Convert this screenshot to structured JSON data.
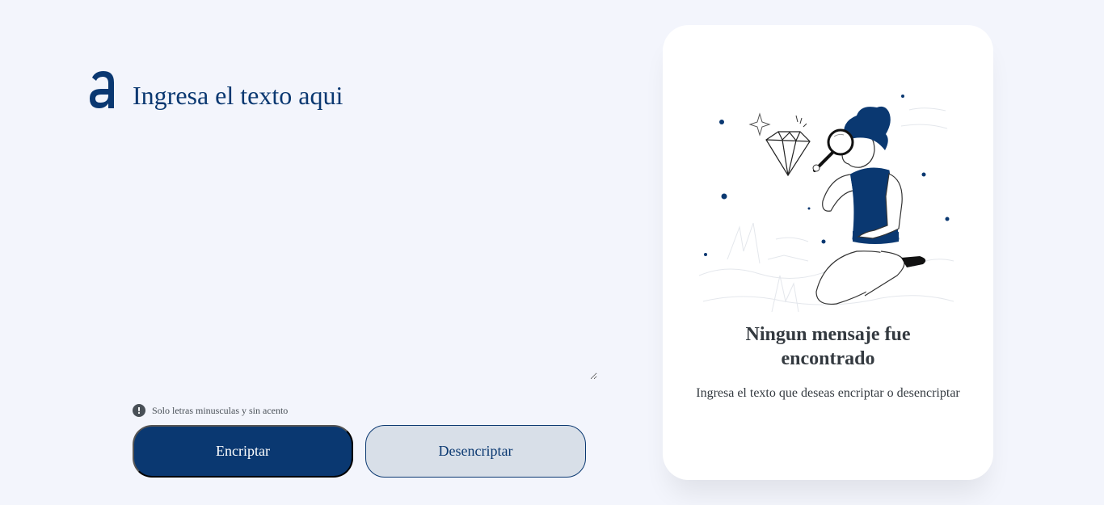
{
  "logo": {
    "icon": "alura-logo-icon"
  },
  "input": {
    "placeholder": "Ingresa el texto aqui",
    "value": ""
  },
  "hint": {
    "icon": "exclamation-circle-icon",
    "text": "Solo letras minusculas y sin acento"
  },
  "buttons": {
    "encrypt_label": "Encriptar",
    "decrypt_label": "Desencriptar"
  },
  "result_card": {
    "illustration": "boy-with-magnifying-glass-illustration",
    "title": "Ningun mensaje fue encontrado",
    "text": "Ingresa el texto que deseas encriptar o desencriptar"
  },
  "colors": {
    "background": "#f3f5fc",
    "primary": "#0a3871",
    "secondary_button": "#d8dfe8",
    "text_dark": "#343a40",
    "hint_gray": "#495057"
  }
}
